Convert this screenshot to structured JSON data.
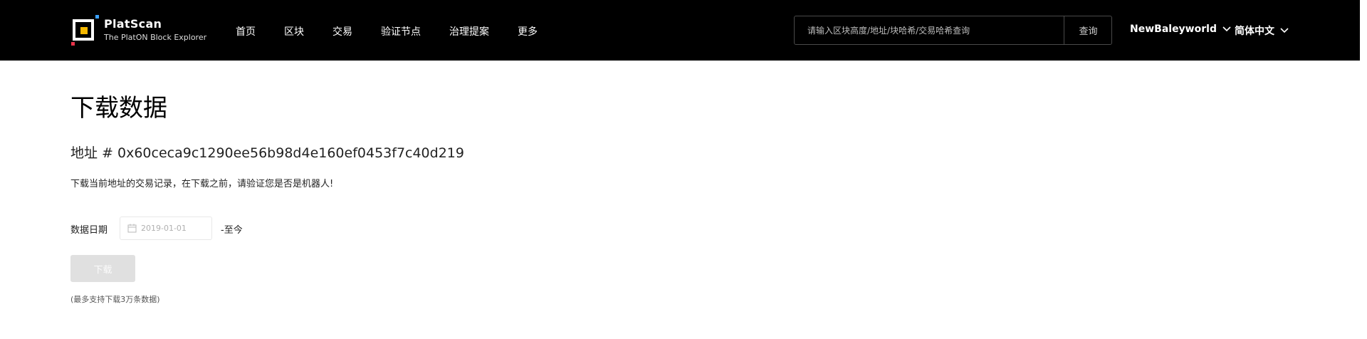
{
  "brand": {
    "name": "PlatScan",
    "subtitle": "The PlatON Block Explorer",
    "colors": {
      "logo_core": "#f5b800",
      "logo_dot_1": "#3ba0ff",
      "logo_dot_2": "#e8334a"
    }
  },
  "nav": {
    "items": [
      {
        "label": "首页"
      },
      {
        "label": "区块"
      },
      {
        "label": "交易"
      },
      {
        "label": "验证节点"
      },
      {
        "label": "治理提案"
      },
      {
        "label": "更多"
      }
    ]
  },
  "search": {
    "placeholder": "请输入区块高度/地址/块哈希/交易哈希查询",
    "button_label": "查询"
  },
  "network_select": {
    "value": "NewBaleyworld",
    "icon": "chevron-down-icon"
  },
  "language_select": {
    "value": "简体中文",
    "icon": "chevron-down-icon"
  },
  "main": {
    "title": "下载数据",
    "address_line": "地址 # 0x60ceca9c1290ee56b98d4e160ef0453f7c40d219",
    "description": "下载当前地址的交易记录，在下载之前，请验证您是否是机器人!",
    "date_label": "数据日期",
    "date_value": "2019-01-01",
    "date_icon": "calendar-icon",
    "until_label": "-至今",
    "download_label": "下载",
    "note": "(最多支持下载3万条数据)"
  },
  "colors": {
    "header_bg": "#000000",
    "download_disabled_bg": "#e0e0e0"
  }
}
